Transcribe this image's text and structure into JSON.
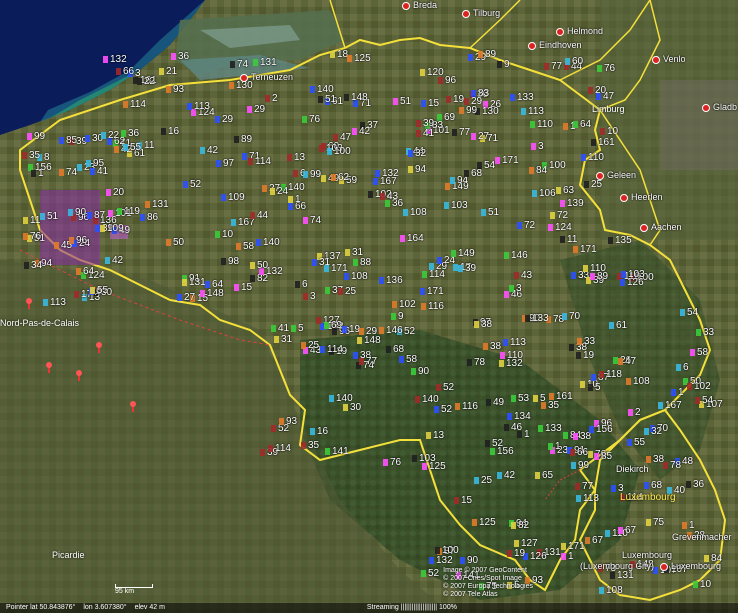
{
  "map": {
    "cities": [
      {
        "name": "Breda",
        "key": "breda"
      },
      {
        "name": "Tilburg",
        "key": "tilburg"
      },
      {
        "name": "Helmond",
        "key": "helmond"
      },
      {
        "name": "Eindhoven",
        "key": "eindhoven"
      },
      {
        "name": "Venlo",
        "key": "venlo"
      },
      {
        "name": "Terneuzen",
        "key": "terneuzen"
      },
      {
        "name": "Gladb",
        "key": "gladbach"
      },
      {
        "name": "Geleen",
        "key": "geleen"
      },
      {
        "name": "Heerlen",
        "key": "heerlen"
      },
      {
        "name": "Aachen",
        "key": "aachen"
      },
      {
        "name": "Diekirch",
        "key": "diekirch"
      },
      {
        "name": "Grevenmacher",
        "key": "grevenmacher"
      },
      {
        "name": "Luxembourg",
        "key": "luxcity"
      }
    ],
    "luxembourg_city_label": "(Luxembourg City)",
    "regions": {
      "limburg": "Limburg",
      "nord_pas_de_calais": "Nord-Pas-de-Calais",
      "picardie": "Picardie",
      "luxembourg_country": "Luxembourg"
    },
    "markers": [
      "1",
      "2",
      "3",
      "5",
      "6",
      "8",
      "9",
      "10",
      "11",
      "13",
      "15",
      "16",
      "17",
      "18",
      "19",
      "20",
      "21",
      "22",
      "23",
      "24",
      "25",
      "26",
      "27",
      "28",
      "29",
      "30",
      "31",
      "32",
      "33",
      "34",
      "35",
      "36",
      "37",
      "38",
      "39",
      "40",
      "41",
      "42",
      "43",
      "44",
      "45",
      "46",
      "47",
      "48",
      "49",
      "50",
      "51",
      "52",
      "53",
      "54",
      "55",
      "56",
      "57",
      "58",
      "59",
      "60",
      "61",
      "62",
      "63",
      "64",
      "65",
      "66",
      "67",
      "68",
      "69",
      "70",
      "71",
      "72",
      "73",
      "74",
      "75",
      "76",
      "77",
      "78",
      "79",
      "80",
      "81",
      "82",
      "83",
      "84",
      "85",
      "86",
      "87",
      "88",
      "89",
      "90",
      "91",
      "92",
      "93",
      "94",
      "95",
      "96",
      "97",
      "98",
      "99",
      "100",
      "101",
      "102",
      "103",
      "104",
      "106",
      "107",
      "108",
      "109",
      "110",
      "113",
      "114",
      "116",
      "118",
      "119",
      "120",
      "124",
      "125",
      "126",
      "127",
      "128",
      "130",
      "131",
      "132",
      "133",
      "134",
      "135",
      "136",
      "137",
      "139",
      "140",
      "141",
      "146",
      "148",
      "149",
      "156",
      "161",
      "164",
      "167",
      "171",
      "608"
    ]
  },
  "credits": {
    "line1": "Image © 2007 GeoContent",
    "line2": "© 2007 Cnes/Spot Image",
    "line3": "© 2007 Europa Technologies",
    "line4": "© 2007 Tele Atlas"
  },
  "scale": {
    "label": "95 km"
  },
  "statusbar": {
    "pointer": "Pointer  lat  50.843876°",
    "lon": "lon   3.607380°",
    "elev": "elev   42 m",
    "streaming": "Streaming |||||||||||||||||||| 100%"
  }
}
